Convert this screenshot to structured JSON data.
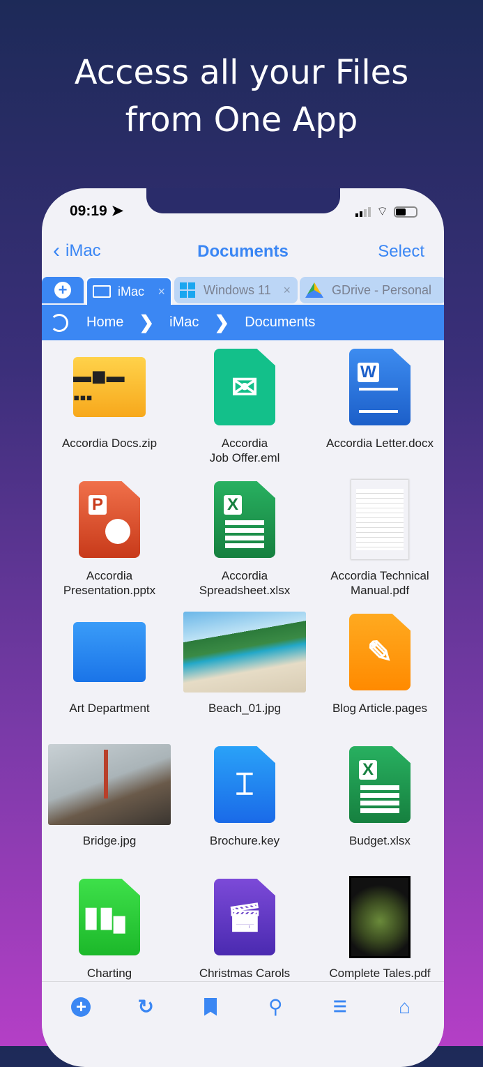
{
  "headline": [
    "Access all your Files",
    "from One App"
  ],
  "status": {
    "time": "09:19"
  },
  "nav": {
    "back": "iMac",
    "title": "Documents",
    "select": "Select"
  },
  "tabs": [
    {
      "label": "iMac",
      "close": "×"
    },
    {
      "label": "Windows 11",
      "close": "×"
    },
    {
      "label": "GDrive - Personal"
    }
  ],
  "breadcrumb": [
    "Home",
    "iMac",
    "Documents"
  ],
  "files": [
    {
      "name": "Accordia Docs.zip",
      "type": "zip"
    },
    {
      "name": "Accordia\nJob Offer.eml",
      "type": "eml"
    },
    {
      "name": "Accordia Letter.docx",
      "type": "docx"
    },
    {
      "name": "Accordia\nPresentation.pptx",
      "type": "pptx"
    },
    {
      "name": "Accordia\nSpreadsheet.xlsx",
      "type": "xlsx"
    },
    {
      "name": "Accordia Technical\nManual.pdf",
      "type": "pdf"
    },
    {
      "name": "Art Department",
      "type": "folder"
    },
    {
      "name": "Beach_01.jpg",
      "type": "beach"
    },
    {
      "name": "Blog Article.pages",
      "type": "pages"
    },
    {
      "name": "Bridge.jpg",
      "type": "bridge"
    },
    {
      "name": "Brochure.key",
      "type": "key"
    },
    {
      "name": "Budget.xlsx",
      "type": "xlsx"
    },
    {
      "name": "Charting",
      "type": "numbers"
    },
    {
      "name": "Christmas Carols",
      "type": "clip"
    },
    {
      "name": "Complete Tales.pdf",
      "type": "book"
    }
  ],
  "colors": {
    "accent": "#3b87f3",
    "background": "#f2f2f7"
  }
}
